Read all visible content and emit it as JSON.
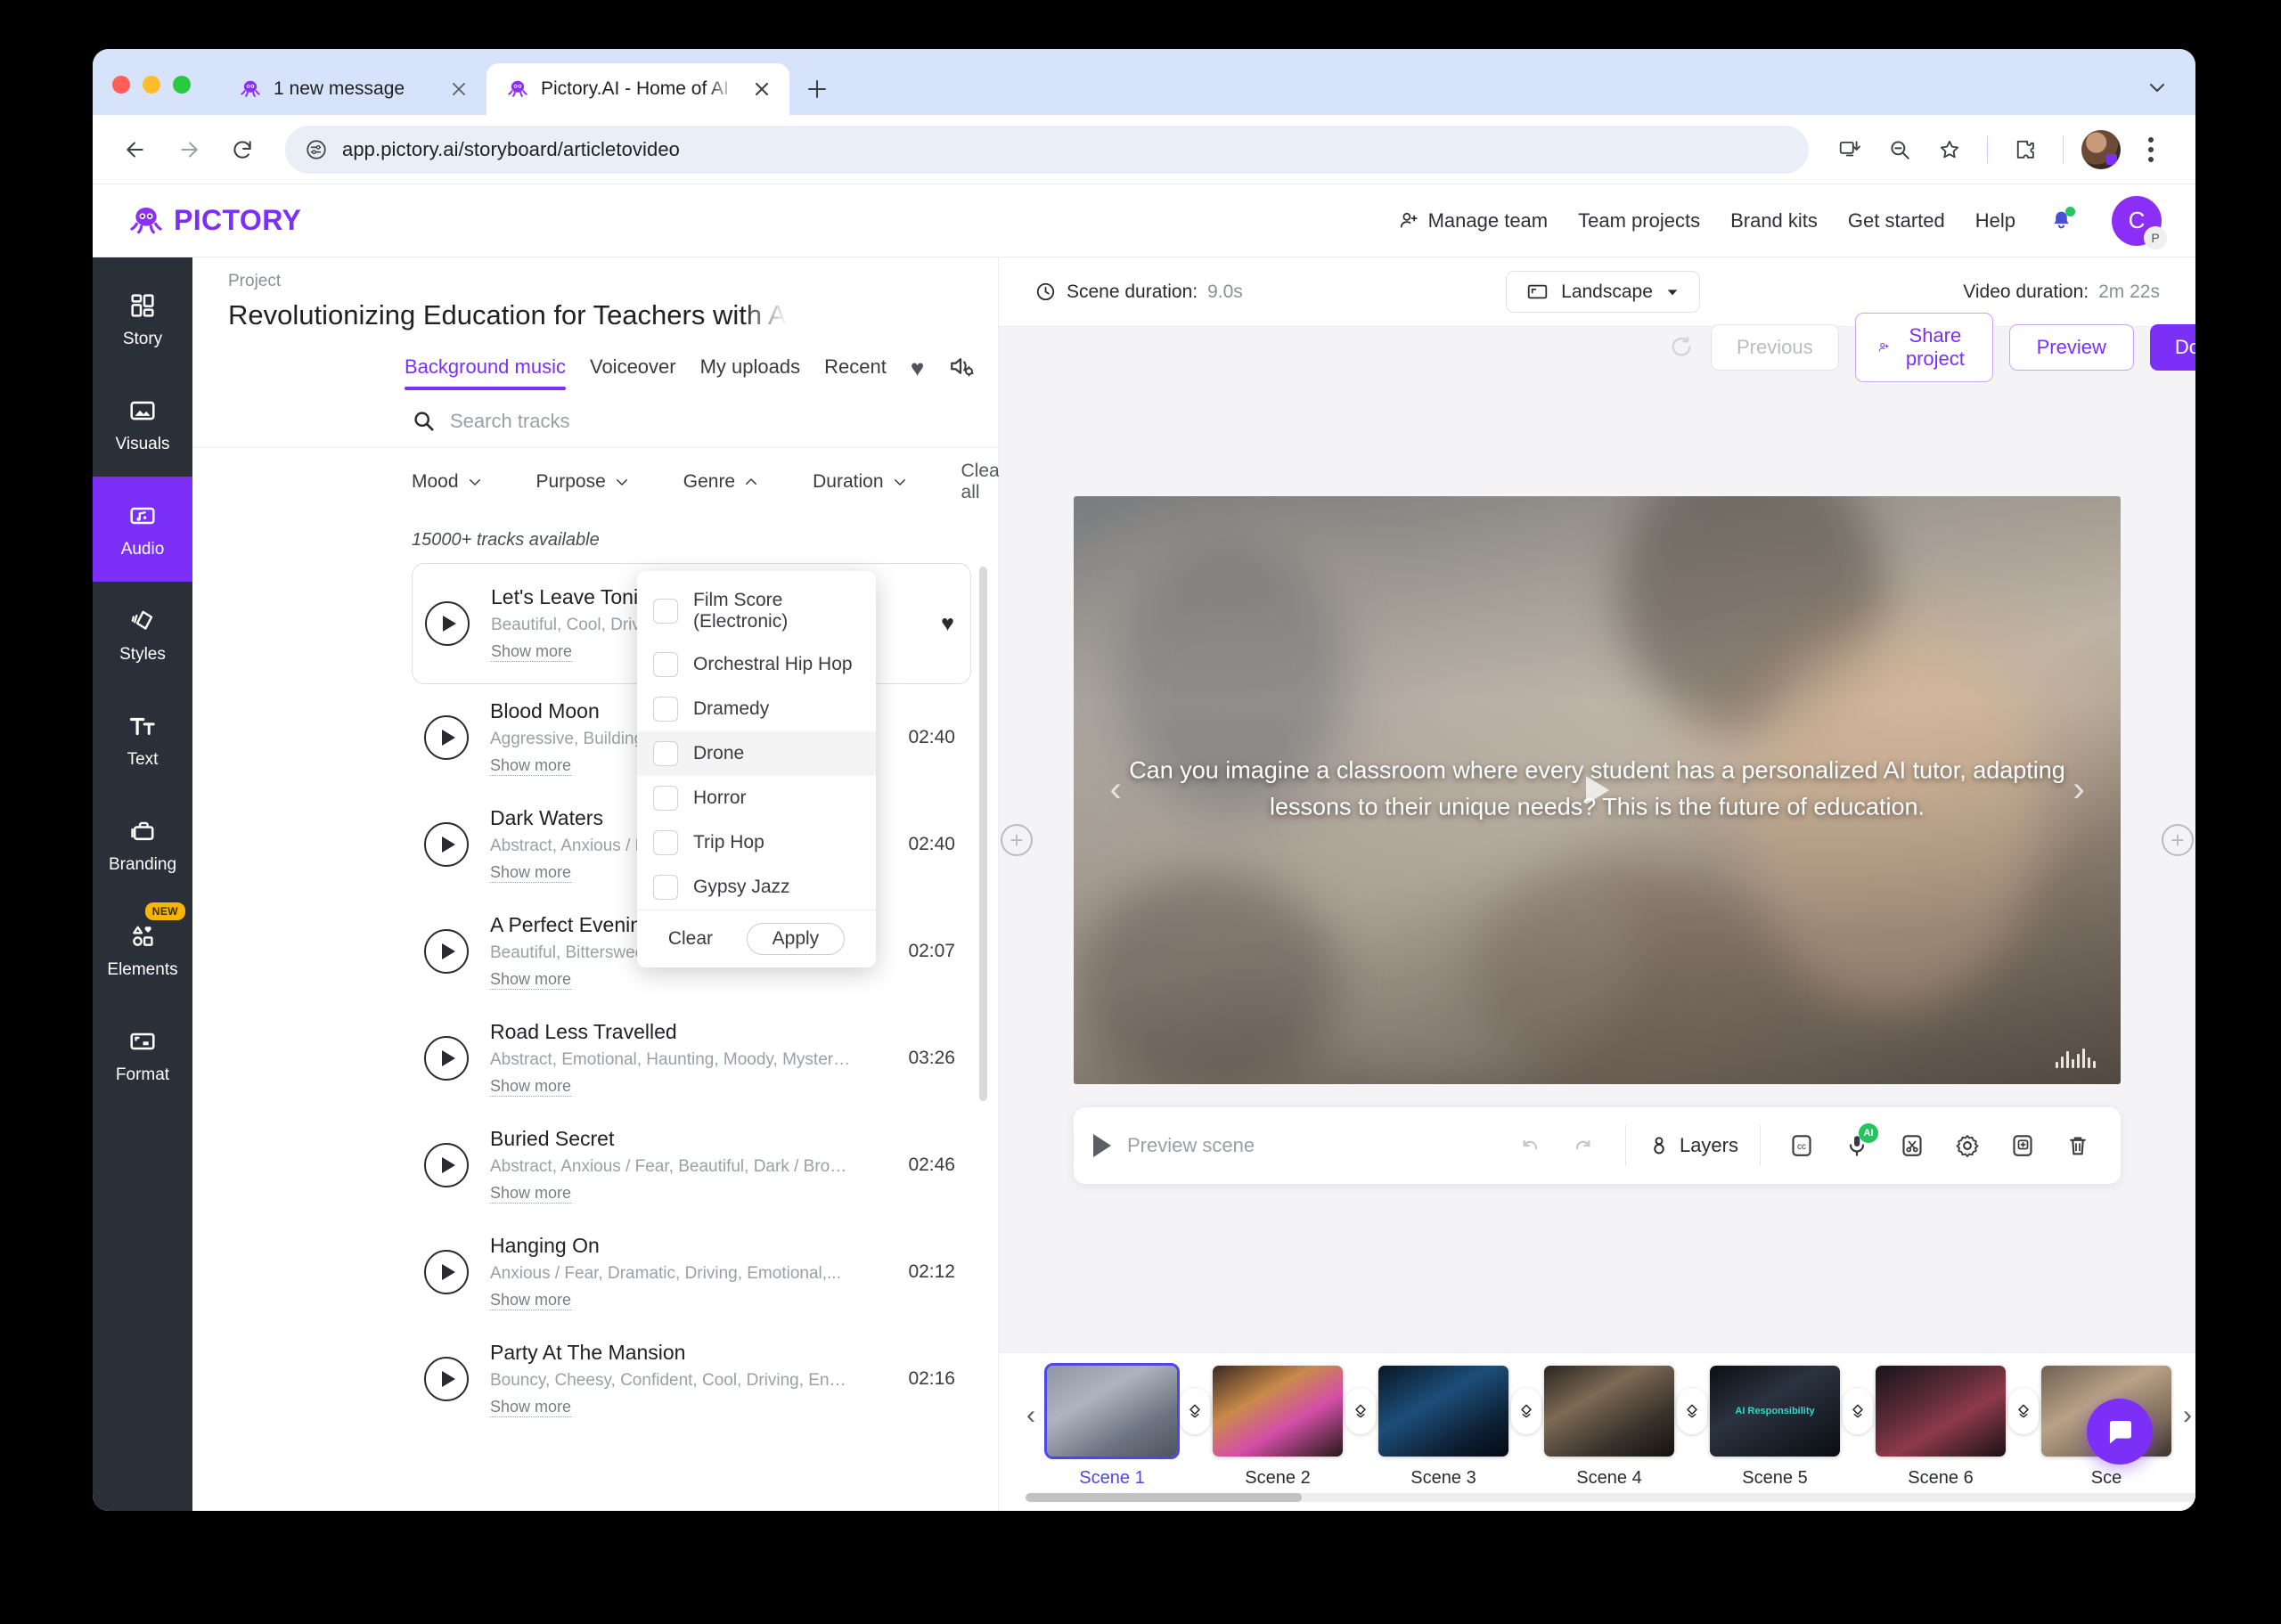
{
  "browser": {
    "tabs": [
      {
        "title": "1 new message",
        "active": false,
        "favicon": "octopus-icon"
      },
      {
        "title": "Pictory.AI - Home of AI Video",
        "active": true,
        "favicon": "octopus-icon"
      }
    ],
    "new_tab_label": "+",
    "url": "app.pictory.ai/storyboard/articletovideo",
    "toolbar_icons": [
      "install-app-icon",
      "zoom-out-icon",
      "bookmark-star-icon",
      "extensions-puzzle-icon",
      "profile-avatar",
      "kebab-menu-icon"
    ]
  },
  "app_header": {
    "brand": "PICTORY",
    "nav": [
      {
        "label": "Manage team",
        "icon": "add-person-icon"
      },
      {
        "label": "Team projects",
        "icon": ""
      },
      {
        "label": "Brand kits",
        "icon": ""
      },
      {
        "label": "Get started",
        "icon": ""
      },
      {
        "label": "Help",
        "icon": ""
      }
    ],
    "notifications_icon": "bell-icon",
    "avatar_initial": "C",
    "avatar_badge": "P"
  },
  "rail": {
    "items": [
      {
        "label": "Story",
        "icon": "grid-icon",
        "active": false,
        "badge": ""
      },
      {
        "label": "Visuals",
        "icon": "image-icon",
        "active": false,
        "badge": ""
      },
      {
        "label": "Audio",
        "icon": "audio-note-icon",
        "active": true,
        "badge": ""
      },
      {
        "label": "Styles",
        "icon": "styles-icon",
        "active": false,
        "badge": ""
      },
      {
        "label": "Text",
        "icon": "text-icon",
        "active": false,
        "badge": ""
      },
      {
        "label": "Branding",
        "icon": "briefcase-icon",
        "active": false,
        "badge": ""
      },
      {
        "label": "Elements",
        "icon": "shapes-icon",
        "active": false,
        "badge": "NEW"
      },
      {
        "label": "Format",
        "icon": "format-icon",
        "active": false,
        "badge": ""
      }
    ]
  },
  "project": {
    "label": "Project",
    "title": "Revolutionizing Education for Teachers with A",
    "refresh_icon": "refresh-icon",
    "buttons": {
      "previous": "Previous",
      "share": "Share project",
      "preview": "Preview",
      "download": "Download"
    }
  },
  "audio_panel": {
    "tabs": [
      {
        "label": "Background music",
        "active": true
      },
      {
        "label": "Voiceover",
        "active": false
      },
      {
        "label": "My uploads",
        "active": false
      },
      {
        "label": "Recent",
        "active": false
      }
    ],
    "favorites_icon": "heart-icon",
    "mixer_icon": "audio-settings-icon",
    "search_placeholder": "Search tracks",
    "search_icon": "search-icon",
    "filters": [
      {
        "label": "Mood",
        "state": "closed"
      },
      {
        "label": "Purpose",
        "state": "closed"
      },
      {
        "label": "Genre",
        "state": "open"
      },
      {
        "label": "Duration",
        "state": "closed"
      }
    ],
    "clear_all": "Clear all",
    "tracks_available": "15000+ tracks available",
    "show_more": "Show more",
    "tracks": [
      {
        "name": "Let's Leave Tonight",
        "tags": "Beautiful, Cool, Driving, Emotional, E",
        "duration": "",
        "selected": true,
        "favorited": true
      },
      {
        "name": "Blood Moon",
        "tags": "Aggressive, Building / Escalating, Co",
        "duration": "02:40",
        "selected": false,
        "favorited": false
      },
      {
        "name": "Dark Waters",
        "tags": "Abstract, Anxious / Fear, Dark / Brooding, Dramatic...",
        "duration": "02:40",
        "selected": false,
        "favorited": false
      },
      {
        "name": "A Perfect Evening",
        "tags": "Beautiful, Bittersweet, Calm / Serene, Emotional,...",
        "duration": "02:07",
        "selected": false,
        "favorited": false
      },
      {
        "name": "Road Less Travelled",
        "tags": "Abstract, Emotional, Haunting, Moody, Mysterious,...",
        "duration": "03:26",
        "selected": false,
        "favorited": false
      },
      {
        "name": "Buried Secret",
        "tags": "Abstract, Anxious / Fear, Beautiful, Dark / Brooding...",
        "duration": "02:46",
        "selected": false,
        "favorited": false
      },
      {
        "name": "Hanging On",
        "tags": "Anxious / Fear, Dramatic, Driving, Emotional,...",
        "duration": "02:12",
        "selected": false,
        "favorited": false
      },
      {
        "name": "Party At The Mansion",
        "tags": "Bouncy, Cheesy, Confident, Cool, Driving, Energeti...",
        "duration": "02:16",
        "selected": false,
        "favorited": false
      }
    ]
  },
  "genre_menu": {
    "options": [
      {
        "label": "Film Score (Electronic)",
        "checked": false,
        "hover": false
      },
      {
        "label": "Orchestral Hip Hop",
        "checked": false,
        "hover": false
      },
      {
        "label": "Dramedy",
        "checked": false,
        "hover": false
      },
      {
        "label": "Drone",
        "checked": false,
        "hover": true
      },
      {
        "label": "Horror",
        "checked": false,
        "hover": false
      },
      {
        "label": "Trip Hop",
        "checked": false,
        "hover": false
      },
      {
        "label": "Gypsy Jazz",
        "checked": false,
        "hover": false
      }
    ],
    "clear": "Clear",
    "apply": "Apply"
  },
  "preview": {
    "scene_duration_label": "Scene duration:",
    "scene_duration_value": "9.0s",
    "clock_icon": "clock-icon",
    "orientation_label": "Landscape",
    "orientation_icon": "aspect-ratio-icon",
    "video_duration_label": "Video duration:",
    "video_duration_value": "2m 22s",
    "caption": "Can you imagine a classroom where every student has a personalized AI tutor, adapting lessons to their unique needs? This is the future of education.",
    "prev_arrow": "‹",
    "next_arrow": "›",
    "add_scene_left_icon": "add-scene-icon",
    "add_scene_right_icon": "add-scene-icon"
  },
  "scene_tools": {
    "preview_scene": "Preview scene",
    "undo_icon": "undo-icon",
    "redo_icon": "redo-icon",
    "layers_label": "Layers",
    "layers_icon": "layers-icon",
    "icons": [
      {
        "name": "closed-captions-icon",
        "badge": ""
      },
      {
        "name": "microphone-icon",
        "badge": "AI"
      },
      {
        "name": "scissors-icon",
        "badge": ""
      },
      {
        "name": "settings-gear-icon",
        "badge": ""
      },
      {
        "name": "duplicate-icon",
        "badge": ""
      },
      {
        "name": "trash-icon",
        "badge": ""
      }
    ]
  },
  "scene_strip": {
    "prev_arrow": "‹",
    "next_arrow": "›",
    "transition_icon": "transition-diamond-icon",
    "scenes": [
      {
        "label": "Scene 1",
        "active": true,
        "overlay": ""
      },
      {
        "label": "Scene 2",
        "active": false,
        "overlay": ""
      },
      {
        "label": "Scene 3",
        "active": false,
        "overlay": ""
      },
      {
        "label": "Scene 4",
        "active": false,
        "overlay": ""
      },
      {
        "label": "Scene 5",
        "active": false,
        "overlay": "AI Responsibility"
      },
      {
        "label": "Scene 6",
        "active": false,
        "overlay": ""
      },
      {
        "label": "Sce",
        "active": false,
        "overlay": ""
      }
    ]
  },
  "chat": {
    "icon": "chat-bubble-icon"
  },
  "colors": {
    "brand_purple": "#7b2ff7",
    "rail_bg": "#2b2f38",
    "active_scene": "#4f46e5",
    "badge_yellow": "#f7b500",
    "ai_green": "#22c55e"
  }
}
